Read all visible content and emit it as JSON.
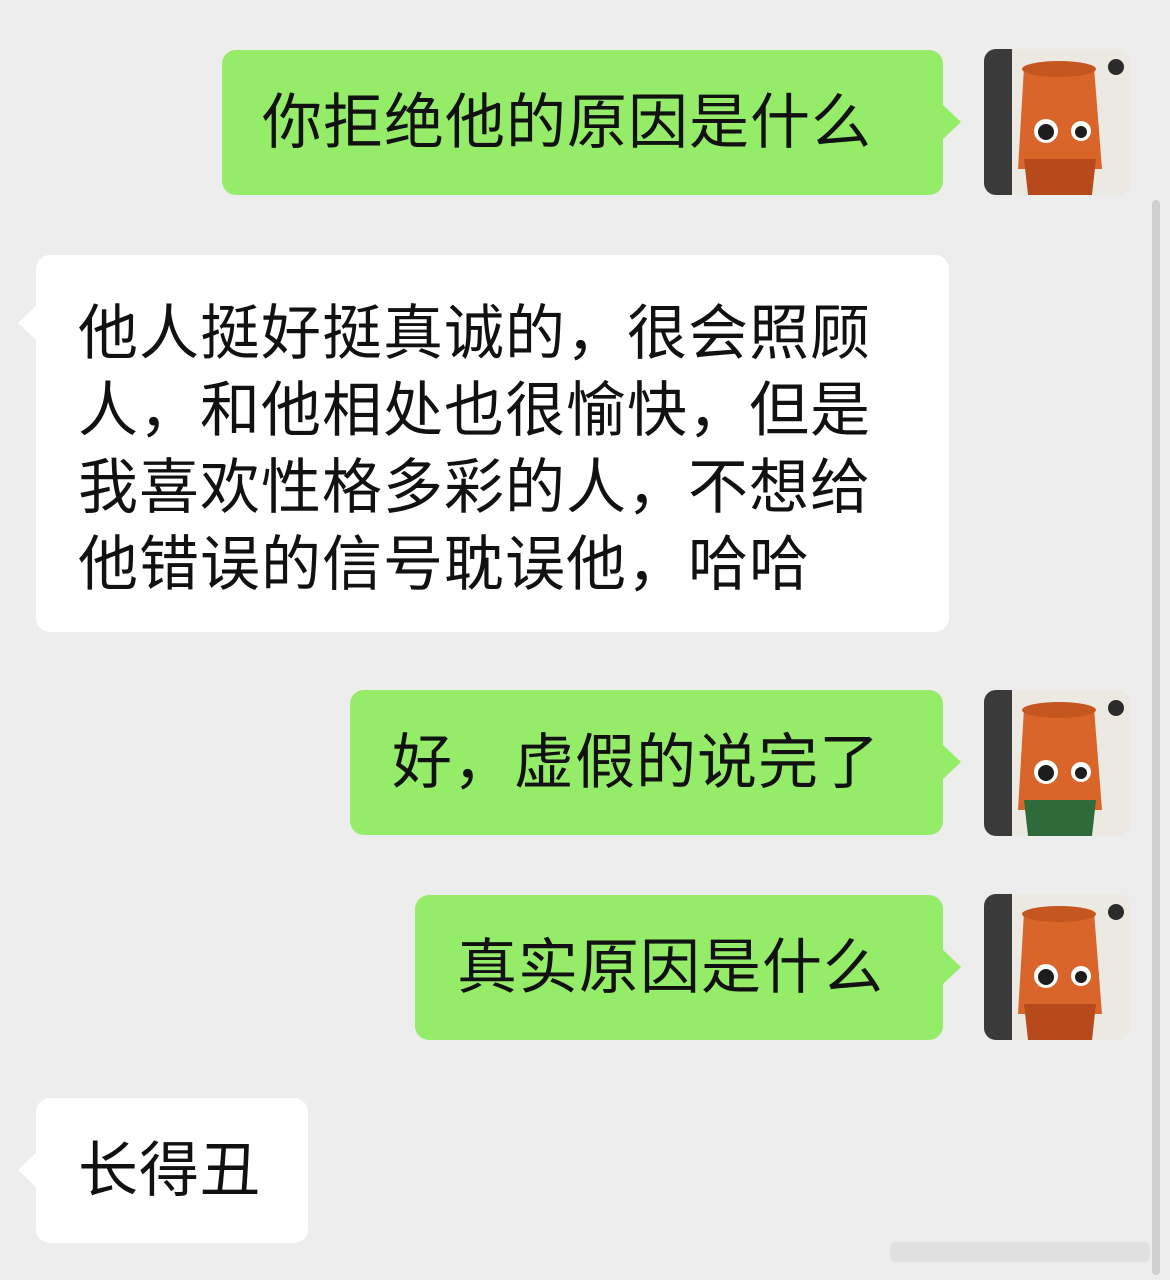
{
  "messages": [
    {
      "id": 1,
      "side": "outgoing",
      "text": "你拒绝他的原因是什么"
    },
    {
      "id": 2,
      "side": "incoming",
      "lines": [
        "他人挺好挺真诚的，很会照顾",
        "人，和他相处也很愉快，但是",
        "我喜欢性格多彩的人，不想给",
        "他错误的信号耽误他，哈哈"
      ]
    },
    {
      "id": 3,
      "side": "outgoing",
      "text": "好，虚假的说完了"
    },
    {
      "id": 4,
      "side": "outgoing",
      "text": "真实原因是什么"
    },
    {
      "id": 5,
      "side": "incoming",
      "text": "长得丑"
    }
  ],
  "avatar": {
    "icon": "toy-figure-avatar-icon"
  },
  "colors": {
    "background": "#ededed",
    "outgoing_bubble": "#95ec69",
    "incoming_bubble": "#ffffff",
    "text": "#111111"
  }
}
